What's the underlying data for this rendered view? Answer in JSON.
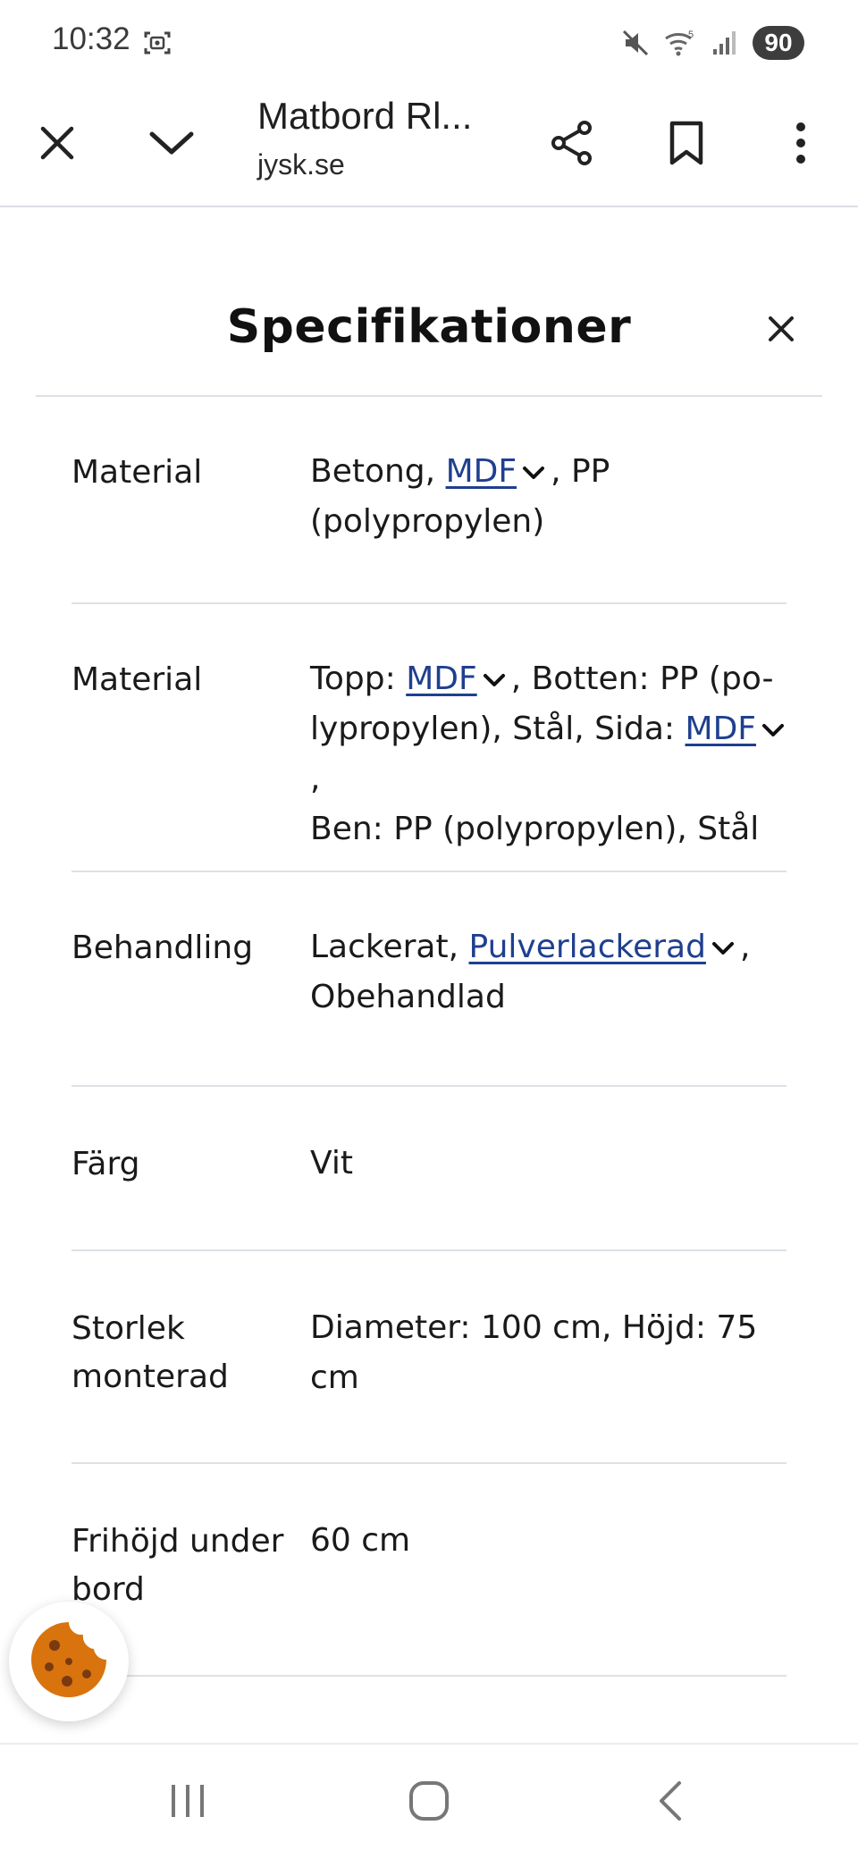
{
  "status_bar": {
    "time": "10:32",
    "battery": "90",
    "icons": [
      "screenshot-icon",
      "mute-icon",
      "wifi-icon",
      "signal-icon"
    ]
  },
  "toolbar": {
    "title": "Matbord Rl...",
    "url": "jysk.se",
    "icons": [
      "close-icon",
      "chevron-down-icon",
      "share-icon",
      "bookmark-icon",
      "more-vert-icon"
    ]
  },
  "panel": {
    "title": "Specifikationer",
    "close_icon": "close-icon"
  },
  "specs": [
    {
      "label": "Material",
      "value": {
        "a": "Betong,",
        "link1": "MDF",
        "b": ", PP",
        "c": "(polypropylen)"
      }
    },
    {
      "label": "Material",
      "value": {
        "a": "Topp:",
        "link1": "MDF",
        "b": ", Botten: PP (po-",
        "c": "lypropylen), Stål, Sida:",
        "link2": "MDF",
        "d": ",",
        "e": "Ben: PP (polypropylen), Stål"
      }
    },
    {
      "label": "Behandling",
      "value": {
        "a": "Lackerat,",
        "link1": "Pulverlackerad",
        "b": ",",
        "c": "Obehandlad"
      }
    },
    {
      "label": "Färg",
      "value": "Vit"
    },
    {
      "label_line1": "Storlek",
      "label_line2": "monterad",
      "value_line1": "Diameter: 100 cm, Höjd: 75",
      "value_line2": "cm"
    },
    {
      "label_line1": "Frihöjd under",
      "label_line2": "bord",
      "value": "60 cm"
    }
  ],
  "colors": {
    "link": "#1f3f8f",
    "divider": "#dde1e6",
    "cookie": "#d9730d",
    "cookie_chips": "#7a3a10"
  },
  "nav_bar": {
    "icons": [
      "recents-icon",
      "home-icon",
      "back-icon"
    ]
  }
}
